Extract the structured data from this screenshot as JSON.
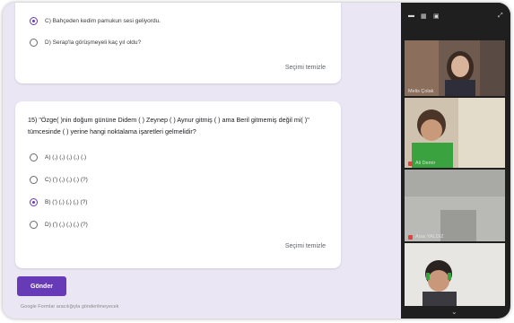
{
  "question14": {
    "option_c": "C) Bahçeden kedim pamukun sesi geliyordu.",
    "option_d": "D) Serap'la görüşmeyeli kaç yıl oldu?",
    "clear_label": "Seçimi temizle"
  },
  "question15": {
    "text": "15) \"Özge( )nin doğum gününe Didem ( ) Zeynep ( ) Aynur gitmiş ( ) ama Beril gitmemiş değil mi( )\" tümcesinde ( ) yerine hangi noktalama işaretleri gelmelidir?",
    "options": [
      "A) (,) (,) (,) (,) (.)",
      "C) (') (,) (,) (.) (?)",
      "B) (') (,) (,) (,) (?)",
      "D) (') (,) (,) (,) (?)"
    ],
    "selected_index": 2,
    "clear_label": "Seçimi temizle"
  },
  "submit_label": "Gönder",
  "footer_text": "Google Formlar aracılığıyla gönderilmeyecek",
  "video_panel": {
    "participants": [
      "Melis Çolak",
      "Ali Demir",
      "Aras YALDIZ",
      ""
    ],
    "controls": [
      "▬",
      "▦",
      "▣",
      "⤢"
    ]
  }
}
